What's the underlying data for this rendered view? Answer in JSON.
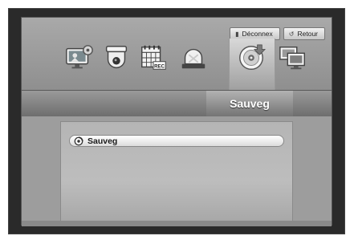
{
  "header": {
    "logout_label": "Déconnex",
    "back_label": "Retour"
  },
  "menu": {
    "icons": [
      "monitor-settings-icon",
      "camera-icon",
      "record-schedule-icon",
      "alarm-icon",
      "backup-disc-icon",
      "network-icon"
    ],
    "record_badge": "REC",
    "selected": "backup-disc-icon"
  },
  "title": "Sauveg",
  "content": {
    "items": [
      {
        "label": "Sauveg",
        "icon": "disc-icon"
      }
    ]
  }
}
